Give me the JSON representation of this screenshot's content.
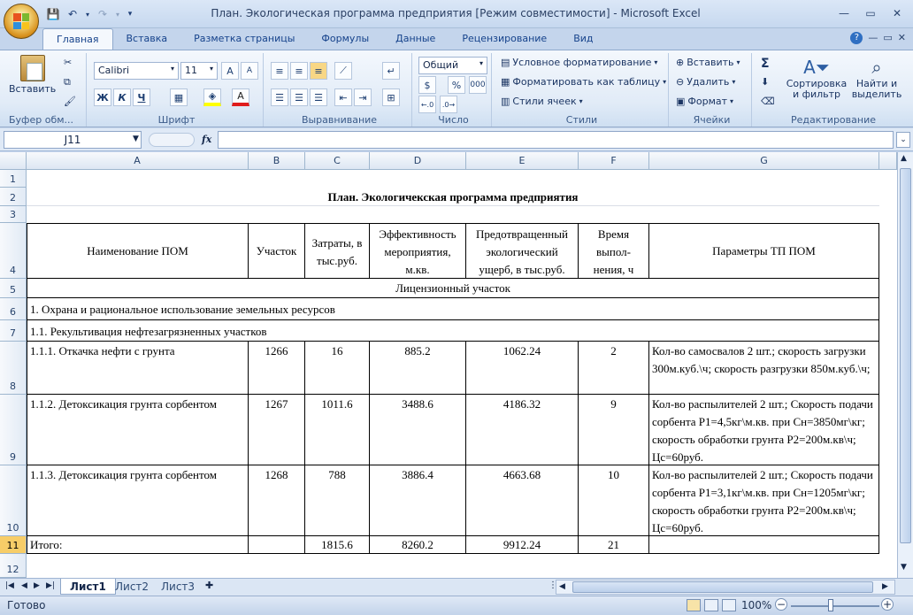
{
  "window": {
    "title": "План. Экологическая программа предприятия  [Режим совместимости] - Microsoft Excel"
  },
  "ribbon": {
    "tabs": [
      "Главная",
      "Вставка",
      "Разметка страницы",
      "Формулы",
      "Данные",
      "Рецензирование",
      "Вид"
    ],
    "active_tab": "Главная",
    "clipboard": {
      "paste": "Вставить",
      "label": "Буфер обм..."
    },
    "font": {
      "name": "Calibri",
      "size": "11",
      "bold": "Ж",
      "italic": "К",
      "underline": "Ч",
      "label": "Шрифт"
    },
    "alignment": {
      "label": "Выравнивание"
    },
    "number": {
      "format": "Общий",
      "percent": "%",
      "thousands": "000",
      "label": "Число"
    },
    "styles": {
      "conditional": "Условное форматирование",
      "as_table": "Форматировать как таблицу",
      "cell_styles": "Стили ячеек",
      "label": "Стили"
    },
    "cells": {
      "insert": "Вставить",
      "delete": "Удалить",
      "format": "Формат",
      "label": "Ячейки"
    },
    "editing": {
      "sigma": "Σ",
      "sort": "Сортировка и фильтр",
      "find": "Найти и выделить",
      "label": "Редактирование"
    }
  },
  "formula_bar": {
    "name_box": "J11",
    "fx": "fx",
    "value": ""
  },
  "columns": [
    "A",
    "B",
    "C",
    "D",
    "E",
    "F",
    "G"
  ],
  "rows": [
    "1",
    "2",
    "3",
    "4",
    "5",
    "6",
    "7",
    "8",
    "9",
    "10",
    "11",
    "12"
  ],
  "sheet": {
    "title": "План. Экологичекская программа предприятия",
    "headers": {
      "name": "Наименование ПОМ",
      "site": "Участок",
      "cost": "Затраты, в тыс.руб.",
      "efficiency": "Эффективность мероприятия, м.кв.",
      "damage": "Предотвращенный экологический ущерб, в тыс.руб.",
      "time": "Время выпол-нения, ч",
      "params": "Параметры ТП ПОМ"
    },
    "section": "Лицензионный участок",
    "group1": "1. Охрана и рациональное использование земельных ресурсов",
    "group11": "1.1. Рекультивация нефтезагрязненных участков",
    "items": [
      {
        "name": "1.1.1. Откачка нефти с грунта",
        "site": "1266",
        "cost": "16",
        "eff": "885.2",
        "damage": "1062.24",
        "time": "2",
        "params": "Кол-во самосвалов 2 шт.; скорость загрузки 300м.куб.\\ч; скорость разгрузки 850м.куб.\\ч;"
      },
      {
        "name": "1.1.2. Детоксикация грунта сорбентом",
        "site": "1267",
        "cost": "1011.6",
        "eff": "3488.6",
        "damage": "4186.32",
        "time": "9",
        "params": "Кол-во распылителей 2 шт.; Скорость подачи сорбента P1=4,5кг\\м.кв. при Сн=3850мг\\кг; скорость обработки грунта P2=200м.кв\\ч; Цс=60руб."
      },
      {
        "name": "1.1.3. Детоксикация грунта сорбентом",
        "site": "1268",
        "cost": "788",
        "eff": "3886.4",
        "damage": "4663.68",
        "time": "10",
        "params": "Кол-во распылителей 2 шт.; Скорость подачи сорбента P1=3,1кг\\м.кв. при Сн=1205мг\\кг; скорость обработки грунта P2=200м.кв\\ч; Цс=60руб."
      }
    ],
    "total": {
      "label": "Итого:",
      "cost": "1815.6",
      "eff": "8260.2",
      "damage": "9912.24",
      "time": "21"
    }
  },
  "sheet_tabs": [
    "Лист1",
    "Лист2",
    "Лист3"
  ],
  "active_sheet": "Лист1",
  "status": {
    "ready": "Готово",
    "zoom": "100%"
  },
  "colors": {
    "selected_row_header": "#f7cd68",
    "ribbon_bg": "#dfe9f6"
  }
}
